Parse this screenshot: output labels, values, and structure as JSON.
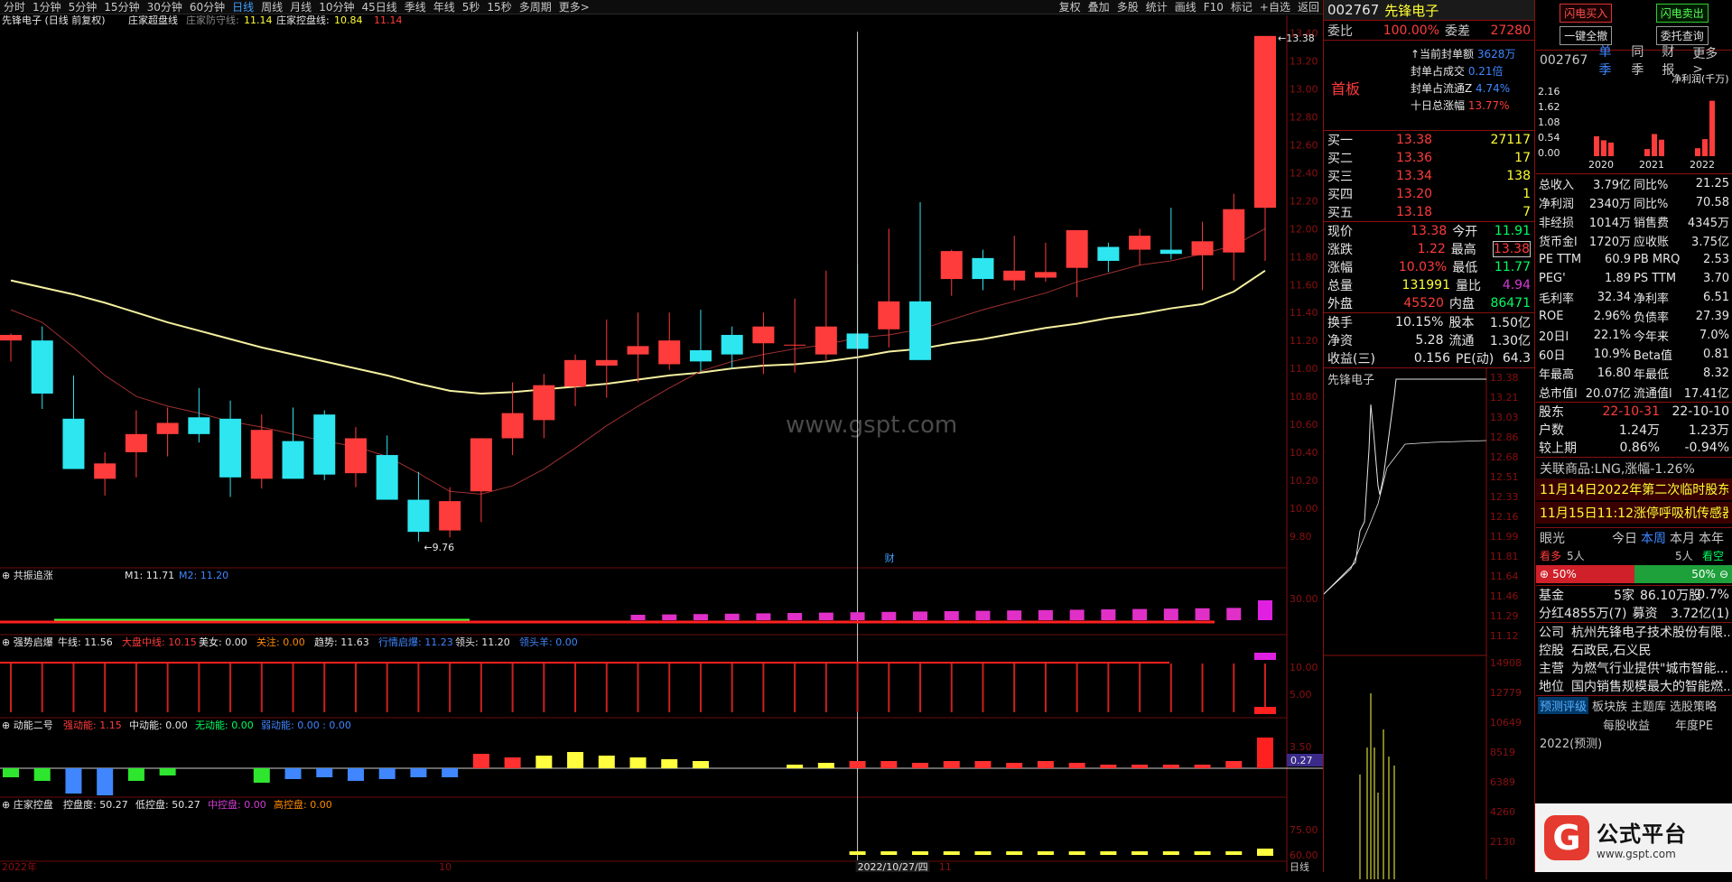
{
  "toolbar": {
    "periods": [
      "分时",
      "1分钟",
      "5分钟",
      "15分钟",
      "30分钟",
      "60分钟",
      "日线",
      "周线",
      "月线",
      "10分钟",
      "45日线",
      "季线",
      "年线",
      "5秒",
      "15秒",
      "多周期",
      "更多>"
    ],
    "active": "日线",
    "tools": [
      "复权",
      "叠加",
      "多股",
      "统计",
      "画线",
      "F10",
      "标记",
      "+自选",
      "返回"
    ]
  },
  "main": {
    "title": "先锋电子 (日线 前复权)",
    "indicator": "庄家超盘线",
    "ind1_label": "庄家防守线:",
    "ind1_value": "11.14",
    "ind2_label": "庄家控盘线:",
    "ind2_value": "10.84",
    "ind3_value": "11.14",
    "high_label": "13.38",
    "low_label": "9.76",
    "watermark": "www.gspt.com",
    "cursor_date": "2022/10/27/四",
    "cai": "财",
    "axis_labels": [
      "13.40",
      "13.20",
      "13.00",
      "12.80",
      "12.60",
      "12.40",
      "12.20",
      "12.00",
      "11.80",
      "11.60",
      "11.40",
      "11.20",
      "11.00",
      "10.80",
      "10.60",
      "10.40",
      "10.20",
      "10.00",
      "9.80"
    ],
    "date_labels": [
      "2022年",
      "10",
      "2022/10/27/四",
      "11"
    ],
    "period": "日线"
  },
  "sub1": {
    "name": "共振追涨",
    "m1": "M1: 11.71",
    "m2": "M2: 11.20",
    "axis": "30.00"
  },
  "sub2": {
    "name": "强势启爆",
    "items": [
      "牛线: 11.56",
      "大盘中线: 10.15",
      "美女: 0.00",
      "关注: 0.00",
      "趋势: 11.63",
      "行情启爆: 11.23",
      "领头: 11.20",
      "领头羊: 0.00"
    ],
    "axis": [
      "10.00",
      "5.00"
    ]
  },
  "sub3": {
    "name": "动能二号",
    "items": [
      "强动能: 1.15",
      "中动能: 0.00",
      "无动能: 0.00",
      "弱动能: 0.00 : 0.00"
    ],
    "axis": "3.50",
    "value": "0.27"
  },
  "sub4": {
    "name": "庄家控盘",
    "items": [
      "控盘度: 50.27",
      "低控盘: 50.27",
      "中控盘: 0.00",
      "高控盘: 0.00"
    ],
    "axis": [
      "75.00",
      "60.00"
    ]
  },
  "chart_data": {
    "type": "candlestick",
    "x": [
      "2022-09-13",
      "2022-09-14",
      "2022-09-15",
      "2022-09-16",
      "2022-09-19",
      "2022-09-20",
      "2022-09-21",
      "2022-09-22",
      "2022-09-23",
      "2022-09-26",
      "2022-09-27",
      "2022-09-28",
      "2022-09-29",
      "2022-09-30",
      "2022-10-10",
      "2022-10-11",
      "2022-10-12",
      "2022-10-13",
      "2022-10-14",
      "2022-10-17",
      "2022-10-18",
      "2022-10-19",
      "2022-10-20",
      "2022-10-21",
      "2022-10-24",
      "2022-10-25",
      "2022-10-26",
      "2022-10-27",
      "2022-10-28",
      "2022-10-31",
      "2022-11-01",
      "2022-11-02",
      "2022-11-03",
      "2022-11-04",
      "2022-11-07",
      "2022-11-08",
      "2022-11-09",
      "2022-11-10",
      "2022-11-11",
      "2022-11-14",
      "2022-11-15"
    ],
    "open": [
      11.2,
      11.2,
      10.64,
      10.21,
      10.4,
      10.53,
      10.65,
      10.64,
      10.21,
      10.48,
      10.67,
      10.25,
      10.38,
      10.06,
      9.84,
      10.12,
      10.5,
      10.63,
      10.87,
      11.02,
      11.1,
      11.03,
      11.13,
      11.24,
      11.18,
      11.17,
      11.1,
      11.25,
      11.28,
      11.48,
      11.64,
      11.79,
      11.63,
      11.65,
      11.72,
      11.87,
      11.85,
      11.85,
      11.81,
      11.83,
      12.15
    ],
    "high": [
      11.25,
      11.3,
      10.95,
      10.4,
      10.7,
      10.72,
      10.86,
      10.77,
      10.67,
      10.72,
      10.7,
      10.58,
      10.52,
      10.26,
      10.15,
      10.31,
      10.9,
      10.96,
      11.1,
      11.35,
      11.4,
      11.4,
      11.42,
      11.3,
      11.4,
      11.5,
      11.7,
      11.75,
      12.0,
      12.19,
      11.85,
      11.85,
      11.95,
      11.9,
      11.95,
      11.9,
      12.0,
      12.15,
      12.05,
      12.25,
      13.38
    ],
    "low": [
      11.05,
      10.71,
      10.36,
      10.09,
      10.22,
      10.37,
      10.47,
      10.08,
      10.14,
      10.21,
      10.2,
      10.15,
      10.24,
      9.76,
      9.79,
      9.9,
      10.38,
      10.5,
      10.73,
      10.79,
      10.9,
      10.99,
      10.98,
      11.0,
      10.96,
      10.97,
      11.06,
      11.15,
      11.15,
      11.21,
      11.52,
      11.56,
      11.56,
      11.62,
      11.51,
      11.69,
      11.74,
      11.78,
      11.56,
      11.63,
      11.77
    ],
    "close": [
      11.24,
      10.82,
      10.28,
      10.32,
      10.53,
      10.61,
      10.53,
      10.22,
      10.56,
      10.21,
      10.24,
      10.5,
      10.06,
      9.83,
      10.05,
      10.5,
      10.68,
      10.88,
      11.06,
      11.06,
      11.16,
      11.2,
      11.05,
      11.1,
      11.3,
      11.17,
      11.3,
      11.14,
      11.48,
      11.06,
      11.84,
      11.64,
      11.7,
      11.69,
      11.99,
      11.77,
      11.95,
      11.82,
      11.91,
      12.14,
      13.38
    ],
    "ma_fast": [
      11.42,
      11.33,
      11.15,
      10.95,
      10.8,
      10.73,
      10.68,
      10.62,
      10.58,
      10.53,
      10.48,
      10.44,
      10.37,
      10.25,
      10.12,
      10.1,
      10.16,
      10.28,
      10.43,
      10.59,
      10.73,
      10.86,
      10.98,
      11.05,
      11.1,
      11.14,
      11.17,
      11.22,
      11.24,
      11.28,
      11.35,
      11.42,
      11.48,
      11.54,
      11.62,
      11.68,
      11.74,
      11.77,
      11.82,
      11.88,
      12.0
    ],
    "ma_slow": [
      11.63,
      11.58,
      11.53,
      11.47,
      11.4,
      11.33,
      11.27,
      11.21,
      11.15,
      11.1,
      11.05,
      11.0,
      10.95,
      10.89,
      10.84,
      10.82,
      10.83,
      10.85,
      10.87,
      10.89,
      10.92,
      10.95,
      10.97,
      11.0,
      11.02,
      11.03,
      11.05,
      11.08,
      11.12,
      11.14,
      11.18,
      11.21,
      11.25,
      11.29,
      11.32,
      11.36,
      11.39,
      11.43,
      11.46,
      11.55,
      11.7
    ],
    "ylim": [
      9.65,
      13.45
    ],
    "ylabel": "",
    "xlabel": ""
  },
  "stock": {
    "code": "002767",
    "name": "先锋电子",
    "weibi_label": "委比",
    "weibi": "100.00%",
    "weicha_label": "委差",
    "weicha": "27280",
    "board": "首板",
    "seal": [
      [
        "↑当前封单额",
        "3628万"
      ],
      [
        "封单占成交",
        "0.21倍"
      ],
      [
        "封单占流通Z",
        "4.74%"
      ],
      [
        "十日总涨幅",
        "13.77%"
      ]
    ],
    "buy": [
      [
        "买一",
        "13.38",
        "27117"
      ],
      [
        "买二",
        "13.36",
        "17"
      ],
      [
        "买三",
        "13.34",
        "138"
      ],
      [
        "买四",
        "13.20",
        "1"
      ],
      [
        "买五",
        "13.18",
        "7"
      ]
    ],
    "quote": [
      [
        "现价",
        "13.38",
        "今开",
        "11.91"
      ],
      [
        "涨跌",
        "1.22",
        "最高",
        "13.38"
      ],
      [
        "涨幅",
        "10.03%",
        "最低",
        "11.77"
      ],
      [
        "总量",
        "131991",
        "量比",
        "4.94"
      ],
      [
        "外盘",
        "45520",
        "内盘",
        "86471"
      ]
    ],
    "quote2": [
      [
        "换手",
        "10.15%",
        "股本",
        "1.50亿"
      ],
      [
        "净资",
        "5.28",
        "流通",
        "1.30亿"
      ],
      [
        "收益(三)",
        "0.156",
        "PE(动)",
        "64.3"
      ]
    ],
    "mini_title": "先锋电子",
    "mini_axis": [
      "13.38",
      "13.21",
      "13.03",
      "12.86",
      "12.68",
      "12.51",
      "12.33",
      "12.16",
      "11.99",
      "11.81",
      "11.64",
      "11.46",
      "11.29",
      "11.12"
    ],
    "mini_vol": [
      "14908",
      "12779",
      "10649",
      "8519",
      "6389",
      "4260",
      "2130"
    ]
  },
  "far": {
    "btns": [
      "闪电买入",
      "闪电卖出",
      "一键全撤",
      "委托查询"
    ],
    "code": "002767",
    "tabs": [
      "单季",
      "同季",
      "财报",
      "更多>"
    ],
    "fin_label": "净利润(千万)",
    "fin_axis": [
      "2.16",
      "1.62",
      "1.08",
      "0.54",
      "0.00"
    ],
    "fin_years": [
      "2020",
      "2021",
      "2022"
    ],
    "fin_bars": [
      [
        0.7,
        0.56,
        0.48
      ],
      [
        0.25,
        0.78,
        0.58
      ],
      [
        0.28,
        0.6,
        1.95
      ]
    ],
    "metrics": [
      [
        "总收入",
        "3.79亿",
        "同比%",
        "21.25"
      ],
      [
        "净利润",
        "2340万",
        "同比%",
        "70.58"
      ],
      [
        "非经损",
        "1014万",
        "销售费",
        "4345万"
      ],
      [
        "货币金l",
        "1720万",
        "应收账",
        "3.75亿"
      ],
      [
        "PE TTM",
        "60.9",
        "PB MRQ",
        "2.53"
      ],
      [
        "PEG'",
        "1.89",
        "PS TTM",
        "3.70"
      ],
      [
        "毛利率",
        "32.34",
        "净利率",
        "6.51"
      ],
      [
        "ROE",
        "2.96%",
        "负债率",
        "27.39"
      ],
      [
        "20日l",
        "22.1%",
        "今年来",
        "7.0%"
      ],
      [
        "60日",
        "10.9%",
        "Beta值",
        "0.81"
      ],
      [
        "年最高",
        "16.80",
        "年最低",
        "8.32"
      ],
      [
        "总市值l",
        "20.07亿",
        "流通值l",
        "17.41亿"
      ]
    ],
    "holders": [
      [
        "股东",
        "22-10-31",
        "22-10-10"
      ],
      [
        "户数",
        "1.24万",
        "1.23万"
      ],
      [
        "较上期",
        "0.86%",
        "-0.94%"
      ]
    ],
    "related": "关联商品:LNG,涨幅-1.26%",
    "news": [
      "11月14日2022年第二次临时股东...",
      "11月15日11:12涨停呼吸机传感器..."
    ],
    "eye": "眼光",
    "periods": [
      "今日",
      "本周",
      "本月",
      "本年"
    ],
    "bull": "看多",
    "bull_n": "5人",
    "bear_n": "5人",
    "bear": "看空",
    "bull_pct": "50%",
    "bear_pct": "50%",
    "fund": [
      "基金",
      "5家",
      "86.10万股",
      "0.7%"
    ],
    "dividend": [
      "分红",
      "4855万(7)",
      "募资",
      "3.72亿(1)"
    ],
    "company": [
      "公司",
      "杭州先锋电子技术股份有限..."
    ],
    "control": [
      "控股",
      "石政民,石义民"
    ],
    "business": [
      "主营",
      "为燃气行业提供\"城市智能..."
    ],
    "position": [
      "地位",
      "国内销售规模最大的智能燃..."
    ],
    "rating_tabs": [
      "预测评级",
      "板块族",
      "主题库",
      "选股策略"
    ],
    "forecast_head": [
      "每股收益",
      "年度PE"
    ],
    "forecast_row": "2022(预测)",
    "logo_t1": "公式平台",
    "logo_t2": "www.gspt.com"
  }
}
